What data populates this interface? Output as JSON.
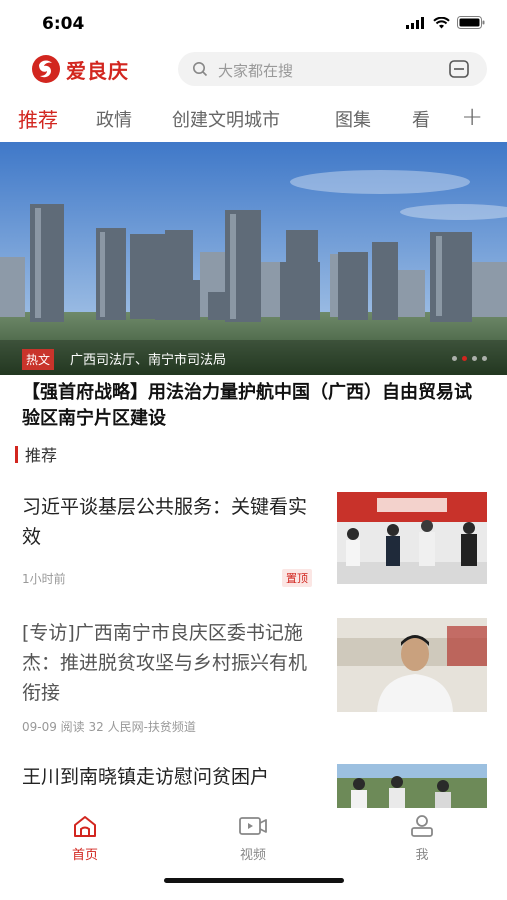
{
  "status_bar": {
    "time": "6:04"
  },
  "header": {
    "logo_text": "爱良庆",
    "search_placeholder": "大家都在搜"
  },
  "tabs": [
    {
      "label": "推荐",
      "active": true
    },
    {
      "label": "政情"
    },
    {
      "label": "创建文明城市"
    },
    {
      "label": "图集"
    },
    {
      "label": "看"
    }
  ],
  "tab_add": "+",
  "banner": {
    "tag": "热文",
    "caption": "广西司法厅、南宁市司法局"
  },
  "headline": "【强首府战略】用法治力量护航中国（广西）自由贸易试验区南宁片区建设",
  "section_title": "推荐",
  "news": [
    {
      "title": "习近平谈基层公共服务：关键看实效",
      "meta": "1小时前",
      "badge": "置顶"
    },
    {
      "title": "[专访]广西南宁市良庆区委书记施杰：推进脱贫攻坚与乡村振兴有机衔接",
      "meta": "09-09  阅读 32  人民网-扶贫频道"
    },
    {
      "title": "王川到南晓镇走访慰问贫困户"
    }
  ],
  "bottom_nav": [
    {
      "label": "首页",
      "icon": "home-icon",
      "active": true
    },
    {
      "label": "视频",
      "icon": "video-icon"
    },
    {
      "label": "我",
      "icon": "profile-icon"
    }
  ],
  "colors": {
    "accent": "#d2261f"
  }
}
